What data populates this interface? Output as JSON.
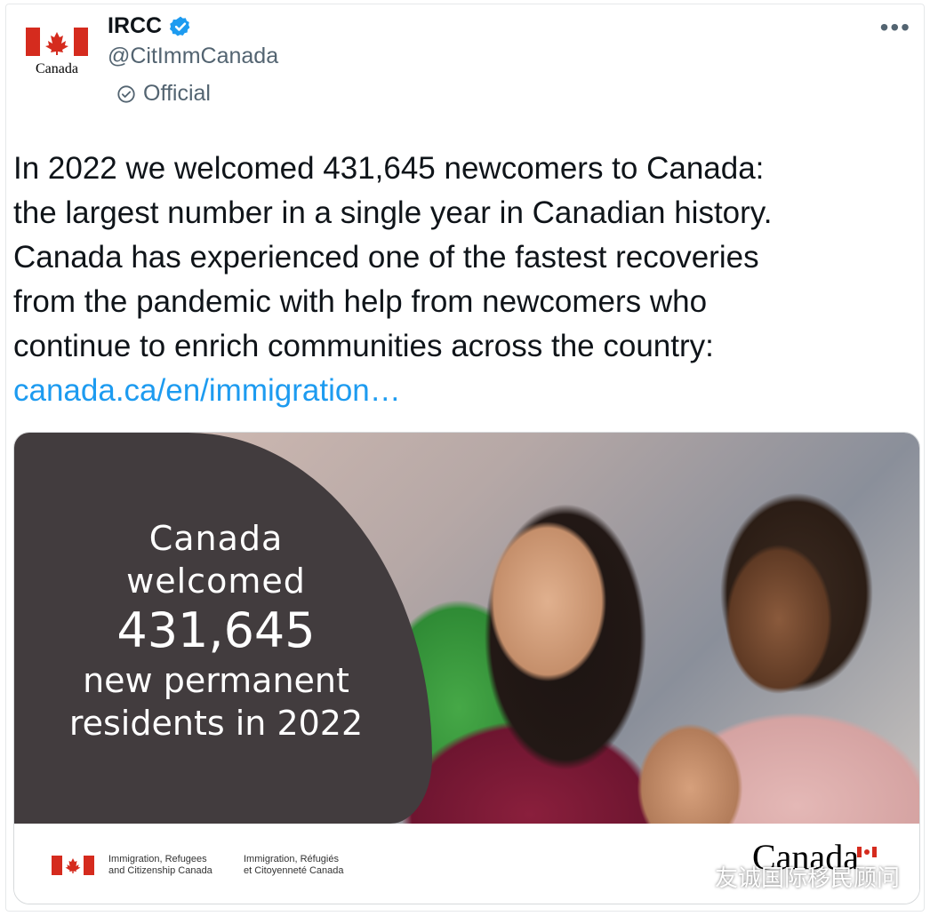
{
  "author": {
    "display_name": "IRCC",
    "handle": "@CitImmCanada",
    "label": "Official",
    "avatar_wordmark": "Canada"
  },
  "more_icon": "more-icon",
  "tweet": {
    "lines": [
      "In 2022 we welcomed 431,645 newcomers to Canada:",
      "the largest number in a single year in Canadian history.",
      "Canada has experienced one of the fastest recoveries",
      "from the pandemic with help from newcomers who",
      "continue to enrich communities across the country:"
    ],
    "link": "canada.ca/en/immigration…"
  },
  "media": {
    "line1": "Canada",
    "line2": "welcomed",
    "number": "431,645",
    "line4": "new permanent",
    "line5": "residents in 2022",
    "dept_en_1": "Immigration, Refugees",
    "dept_en_2": "and Citizenship Canada",
    "dept_fr_1": "Immigration, Réfugiés",
    "dept_fr_2": "et Citoyenneté Canada",
    "wordmark": "Canada"
  },
  "watermark": {
    "text": "友诚国际移民顾问"
  },
  "colors": {
    "link": "#1d9bf0",
    "verified": "#1d9bf0",
    "flag_red": "#d52b1e",
    "media_panel": "#423c3e"
  }
}
